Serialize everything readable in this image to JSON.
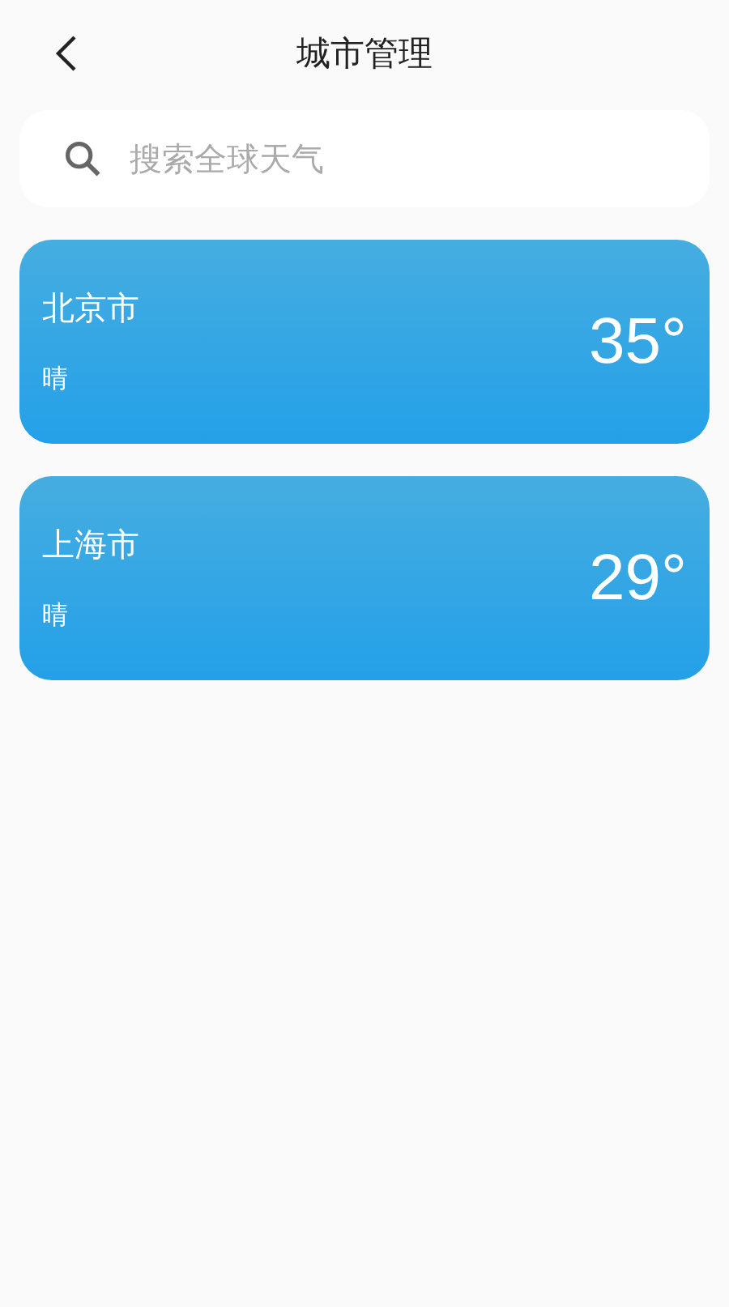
{
  "header": {
    "title": "城市管理"
  },
  "search": {
    "placeholder": "搜索全球天气"
  },
  "cities": [
    {
      "name": "北京市",
      "condition": "晴",
      "temperature": "35°"
    },
    {
      "name": "上海市",
      "condition": "晴",
      "temperature": "29°"
    }
  ]
}
